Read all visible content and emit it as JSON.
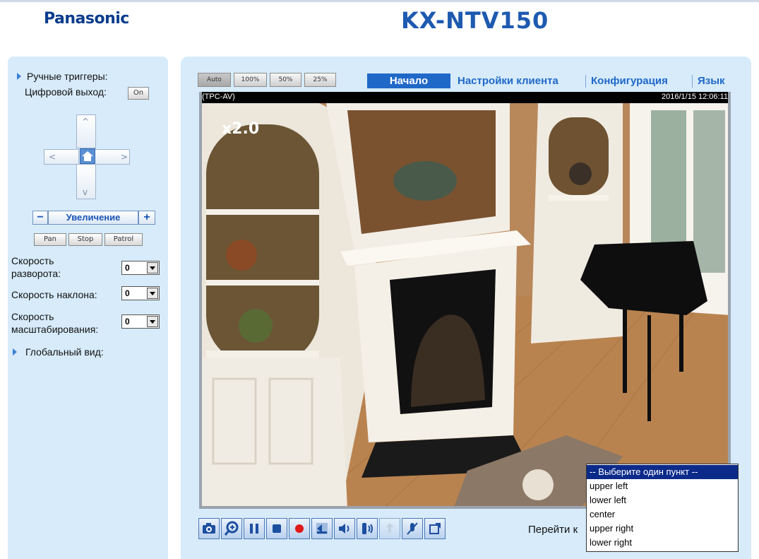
{
  "header": {
    "brand": "Panasonic",
    "model": "KX-NTV150"
  },
  "sidebar": {
    "manual_triggers_label": "Ручные триггеры:",
    "digital_output_label": "Цифровой выход:",
    "digital_output_button": "On",
    "zoom_minus": "−",
    "zoom_label": "Увеличение",
    "zoom_plus": "+",
    "pan_button": "Pan",
    "stop_button": "Stop",
    "patrol_button": "Patrol",
    "pan_speed_label_1": "Скорость",
    "pan_speed_label_2": "разворота:",
    "pan_speed_value": "0",
    "tilt_speed_label": "Скорость наклона:",
    "tilt_speed_value": "0",
    "zoom_speed_label_1": "Скорость",
    "zoom_speed_label_2": "масштабирования:",
    "zoom_speed_value": "0",
    "global_view_label": "Глобальный вид:"
  },
  "view_sizes": [
    "Auto",
    "100%",
    "50%",
    "25%"
  ],
  "nav": {
    "home": "Начало",
    "client_settings": "Настройки клиента",
    "configuration": "Конфигурация",
    "language": "Язык"
  },
  "video": {
    "camera_name": "(TPC-AV)",
    "timestamp": "2016/1/15 12:06:11",
    "zoom_overlay": "x2.0"
  },
  "toolbar": {
    "icons": [
      "camera-snapshot-icon",
      "digital-zoom-icon",
      "pause-icon",
      "stop-icon",
      "record-icon",
      "volume-down-icon",
      "speaker-icon",
      "talk-icon",
      "talk-disabled-icon",
      "mic-mute-icon",
      "fullscreen-icon"
    ],
    "goto_label": "Перейти к"
  },
  "goto_dropdown": {
    "options": [
      "-- Выберите один пункт --",
      "upper left",
      "lower left",
      "center",
      "upper right",
      "lower right"
    ],
    "selected_index": 0
  },
  "colors": {
    "panel_bg": "#d7ebfa",
    "accent_blue": "#1f68c8",
    "brand_blue": "#0a3c8c"
  }
}
